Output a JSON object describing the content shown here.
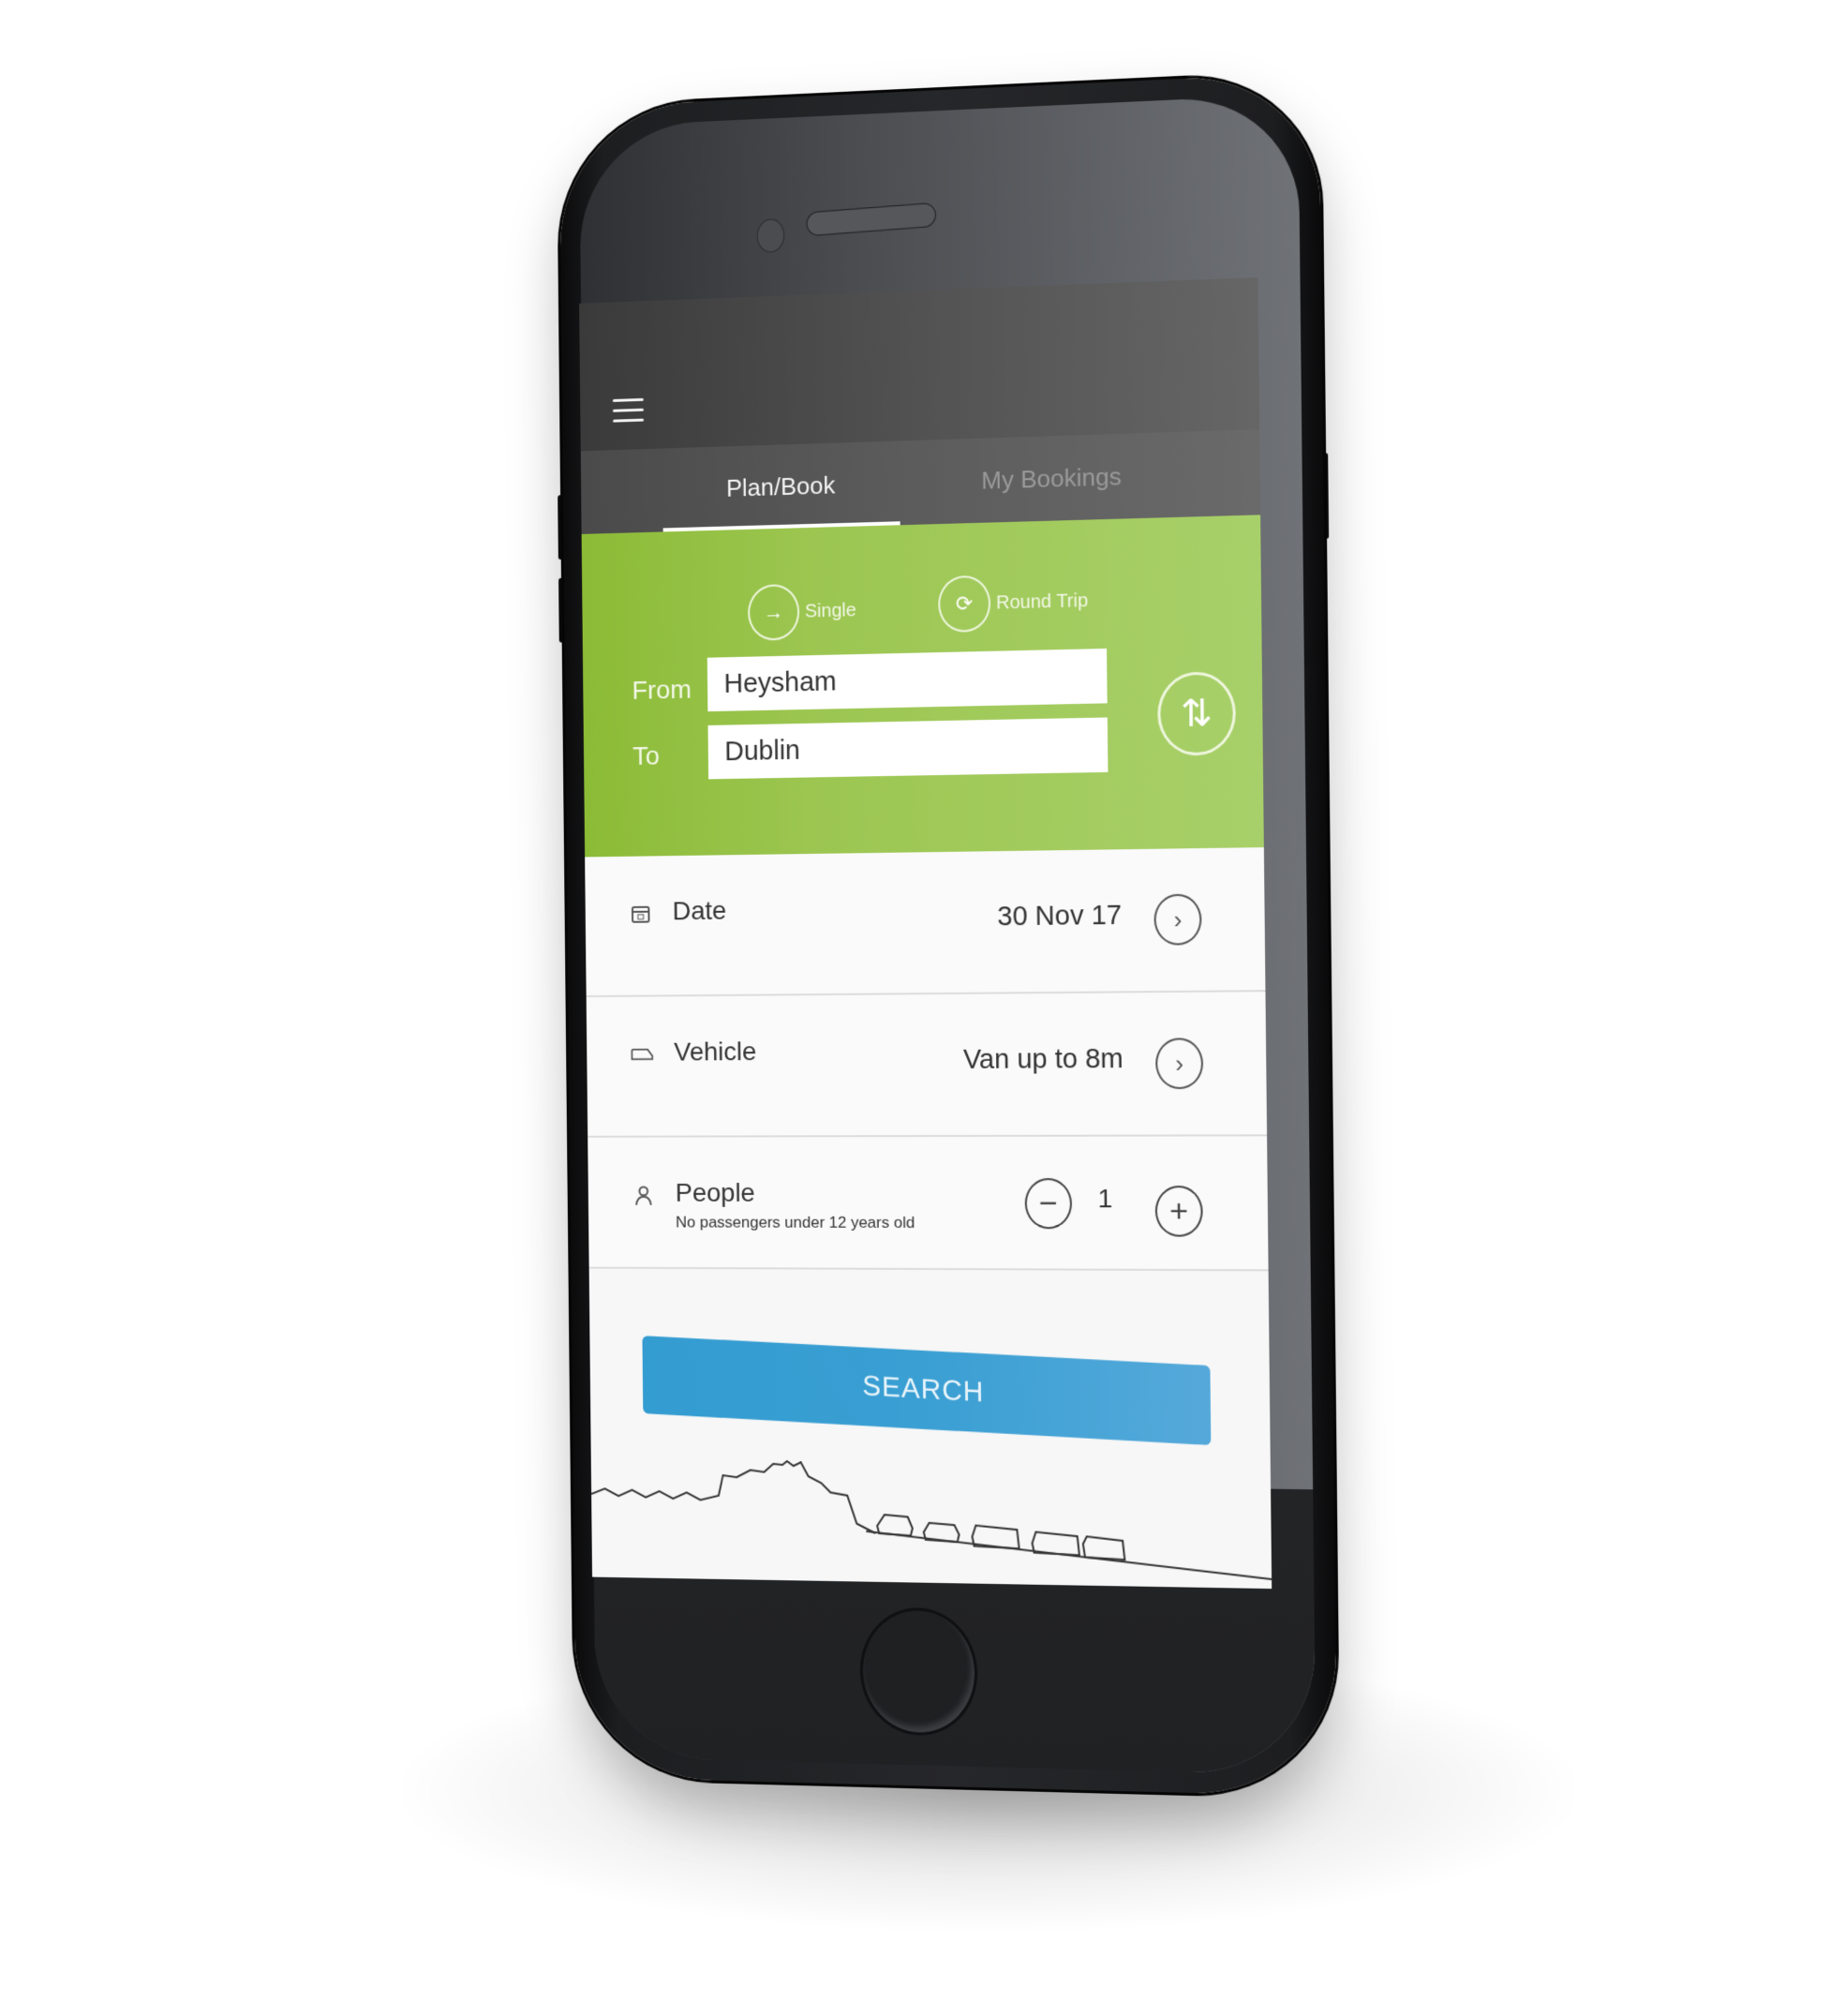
{
  "app": {
    "menu_icon": "hamburger-menu-icon"
  },
  "tabs": [
    {
      "label": "Plan/Book",
      "active": true
    },
    {
      "label": "My Bookings",
      "active": false
    }
  ],
  "trip_type": {
    "options": [
      {
        "label": "Single",
        "icon": "arrow-right-icon",
        "glyph": "→",
        "selected": true
      },
      {
        "label": "Round Trip",
        "icon": "round-trip-icon",
        "glyph": "⟳",
        "selected": false
      }
    ]
  },
  "route": {
    "from_label": "From",
    "from_value": "Heysham",
    "to_label": "To",
    "to_value": "Dublin",
    "swap_icon": "swap-vertical-icon",
    "swap_glyph": "⇅"
  },
  "details": {
    "date": {
      "label": "Date",
      "value": "30 Nov 17",
      "icon": "calendar-icon",
      "chevron": "›"
    },
    "vehicle": {
      "label": "Vehicle",
      "value": "Van up to 8m",
      "icon": "van-icon",
      "chevron": "›"
    },
    "people": {
      "label": "People",
      "note": "No passengers under 12 years old",
      "icon": "person-icon",
      "count": "1",
      "minus": "−",
      "plus": "+"
    }
  },
  "search": {
    "label": "SEARCH"
  },
  "colors": {
    "green": "#9cc651",
    "search_blue": "#339cd1",
    "header_dark": "#4a4a4a"
  }
}
